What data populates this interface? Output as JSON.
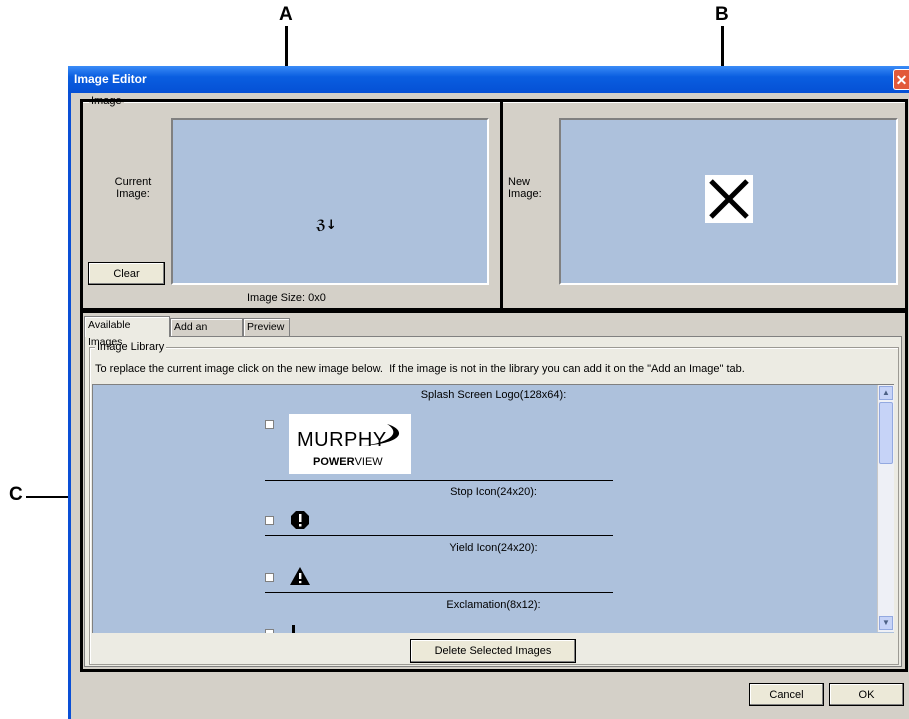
{
  "callouts": {
    "a": "A",
    "b": "B",
    "c": "C"
  },
  "window": {
    "title": "Image Editor",
    "close_glyph": "✕"
  },
  "image_group": {
    "legend": "Image",
    "current_label": "Current\nImage:",
    "new_label": "New\nImage:",
    "clear_button": "Clear",
    "size_text": "Image Size: 0x0",
    "current_glyph": "ℨ↓"
  },
  "tabs": [
    {
      "label": "Available Images",
      "active": true
    },
    {
      "label": "Add an Image",
      "active": false
    },
    {
      "label": "Preview",
      "active": false
    }
  ],
  "library": {
    "legend": "Image Library",
    "instructions": "To replace the current image click on the new image below.  If the image is not in the library you can add it on the \"Add an Image\" tab.",
    "items": [
      {
        "title": "Splash Screen Logo(128x64):",
        "logo_main": "MURPHY",
        "logo_bold": "POWER",
        "logo_rest": "VIEW"
      },
      {
        "title": "Stop Icon(24x20):",
        "glyph": "!"
      },
      {
        "title": "Yield Icon(24x20):",
        "glyph": "!"
      },
      {
        "title": "Exclamation(8x12):"
      }
    ],
    "delete_button": "Delete Selected Images"
  },
  "footer": {
    "cancel_button": "Cancel",
    "ok_button": "OK"
  },
  "colors": {
    "well": "#adc1dc",
    "dialog": "#d4d0c8",
    "title_bar": "#0a5ee0"
  }
}
